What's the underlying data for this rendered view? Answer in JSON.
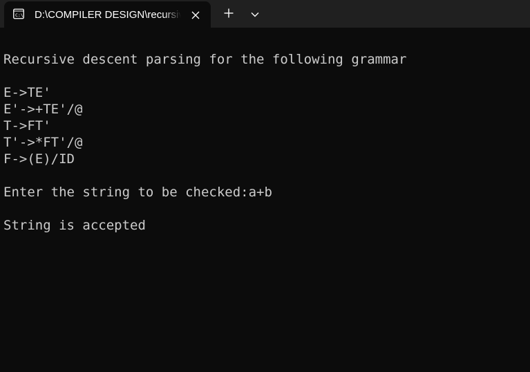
{
  "tab": {
    "title": "D:\\COMPILER DESIGN\\recursive",
    "icon": "cmd-prompt-icon"
  },
  "tabbar": {
    "new_tab_icon": "plus-icon",
    "dropdown_icon": "chevron-down-icon",
    "close_icon": "close-icon"
  },
  "terminal": {
    "heading": "Recursive descent parsing for the following grammar",
    "grammar": [
      "E->TE'",
      "E'->+TE'/@",
      "T->FT'",
      "T'->*FT'/@",
      "F->(E)/ID"
    ],
    "prompt": "Enter the string to be checked:a+b",
    "result": "String is accepted"
  },
  "colors": {
    "background": "#0c0c0c",
    "tabbar": "#202020",
    "text": "#cccccc"
  }
}
